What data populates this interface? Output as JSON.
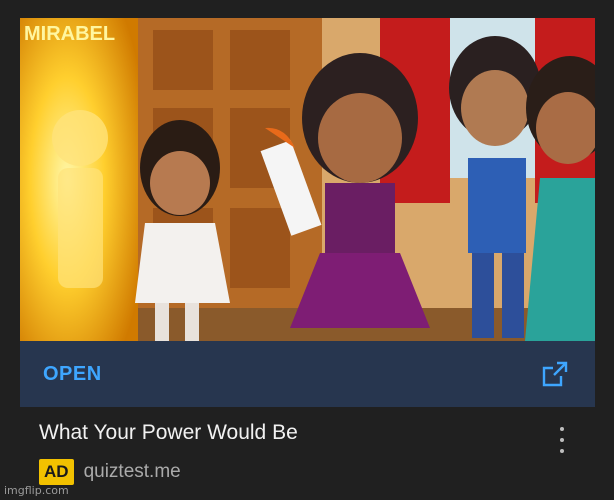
{
  "ad_card": {
    "thumbnail_text": "MIRABEL",
    "open_label": "OPEN",
    "title": "What Your Power Would Be",
    "ad_badge": "AD",
    "domain": "quiztest.me"
  },
  "icons": {
    "external_link": "external-link-icon",
    "more_menu": "more-vert-icon"
  },
  "colors": {
    "background": "#202020",
    "open_bar": "#27364f",
    "open_text": "#3ea6ff",
    "ad_badge": "#f2c100"
  },
  "watermark": "imgflip.com"
}
